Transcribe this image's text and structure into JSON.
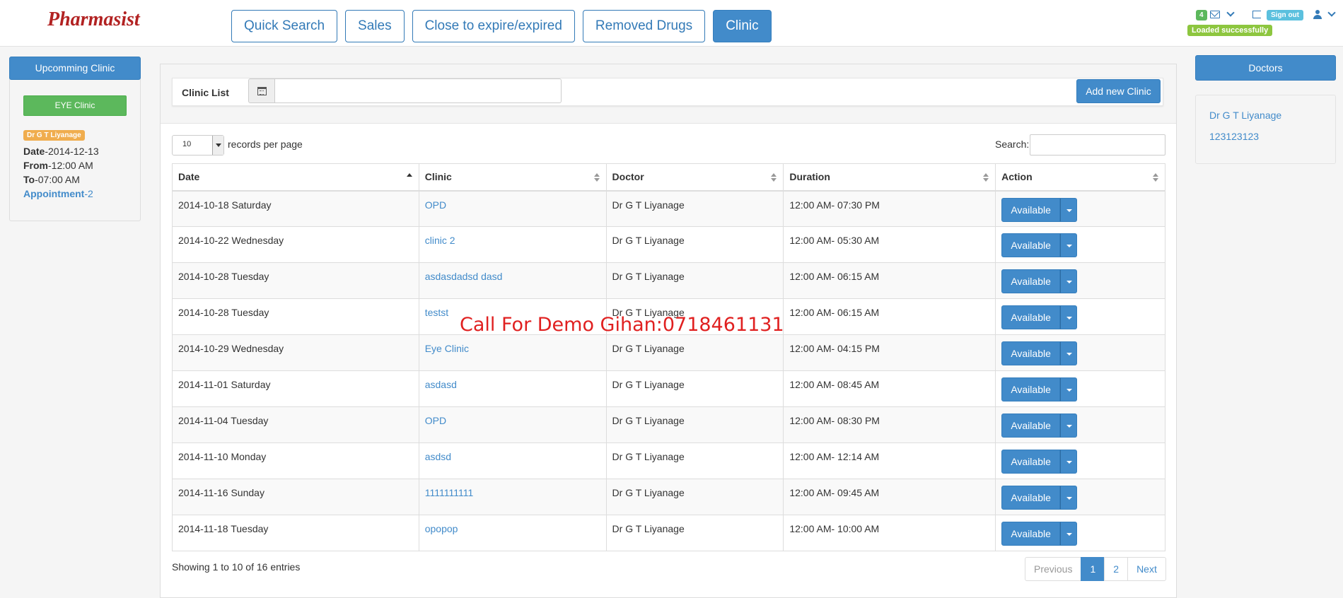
{
  "app": {
    "logo": "Pharmasist"
  },
  "nav": [
    {
      "label": "Quick Search",
      "active": false
    },
    {
      "label": "Sales",
      "active": false
    },
    {
      "label": "Close to expire/expired",
      "active": false
    },
    {
      "label": "Removed Drugs",
      "active": false
    },
    {
      "label": "Clinic",
      "active": true
    }
  ],
  "header_right": {
    "message_count": "4",
    "sign_out_label": "Sign out",
    "status_label": "Loaded successfully"
  },
  "left_panel": {
    "title": "Upcomming Clinic",
    "clinic_button": "EYE Clinic",
    "doctor_badge": "Dr G T Liyanage",
    "date_label": "Date",
    "date_value": "-2014-12-13",
    "from_label": "From",
    "from_value": "-12:00 AM",
    "to_label": "To",
    "to_value": "-07:00 AM",
    "appointment_label": "Appointment",
    "appointment_value": "-2"
  },
  "clinic_list": {
    "label": "Clinic List",
    "date_value": "",
    "add_button": "Add new Clinic"
  },
  "table_controls": {
    "page_length": "10",
    "length_label": "records per page",
    "search_label": "Search:",
    "search_value": ""
  },
  "table": {
    "columns": [
      "Date",
      "Clinic",
      "Doctor",
      "Duration",
      "Action"
    ],
    "rows": [
      {
        "date": "2014-10-18 Saturday",
        "clinic": "OPD",
        "doctor": "Dr G T Liyanage",
        "duration": "12:00 AM- 07:30 PM",
        "action": "Available"
      },
      {
        "date": "2014-10-22 Wednesday",
        "clinic": "clinic 2",
        "doctor": "Dr G T Liyanage",
        "duration": "12:00 AM- 05:30 AM",
        "action": "Available"
      },
      {
        "date": "2014-10-28 Tuesday",
        "clinic": "asdasdadsd dasd",
        "doctor": "Dr G T Liyanage",
        "duration": "12:00 AM- 06:15 AM",
        "action": "Available"
      },
      {
        "date": "2014-10-28 Tuesday",
        "clinic": "testst",
        "doctor": "Dr G T Liyanage",
        "duration": "12:00 AM- 06:15 AM",
        "action": "Available"
      },
      {
        "date": "2014-10-29 Wednesday",
        "clinic": "Eye Clinic",
        "doctor": "Dr G T Liyanage",
        "duration": "12:00 AM- 04:15 PM",
        "action": "Available"
      },
      {
        "date": "2014-11-01 Saturday",
        "clinic": "asdasd",
        "doctor": "Dr G T Liyanage",
        "duration": "12:00 AM- 08:45 AM",
        "action": "Available"
      },
      {
        "date": "2014-11-04 Tuesday",
        "clinic": "OPD",
        "doctor": "Dr G T Liyanage",
        "duration": "12:00 AM- 08:30 PM",
        "action": "Available"
      },
      {
        "date": "2014-11-10 Monday",
        "clinic": "asdsd",
        "doctor": "Dr G T Liyanage",
        "duration": "12:00 AM- 12:14 AM",
        "action": "Available"
      },
      {
        "date": "2014-11-16 Sunday",
        "clinic": "1111111111",
        "doctor": "Dr G T Liyanage",
        "duration": "12:00 AM- 09:45 AM",
        "action": "Available"
      },
      {
        "date": "2014-11-18 Tuesday",
        "clinic": "opopop",
        "doctor": "Dr G T Liyanage",
        "duration": "12:00 AM- 10:00 AM",
        "action": "Available"
      }
    ]
  },
  "footer": {
    "showing": "Showing 1 to 10 of 16 entries",
    "pagination": {
      "previous": "Previous",
      "pages": [
        "1",
        "2"
      ],
      "current": "1",
      "next": "Next"
    }
  },
  "watermark": "Call For Demo Gihan:0718461131",
  "right_panel": {
    "title": "Doctors",
    "doctors": [
      "Dr G T Liyanage",
      "123123123"
    ]
  },
  "colors": {
    "primary": "#428bca",
    "success": "#5cb85c",
    "warning": "#f0ad4e",
    "info": "#5bc0de",
    "logo": "#b22222",
    "watermark": "#e02020"
  }
}
